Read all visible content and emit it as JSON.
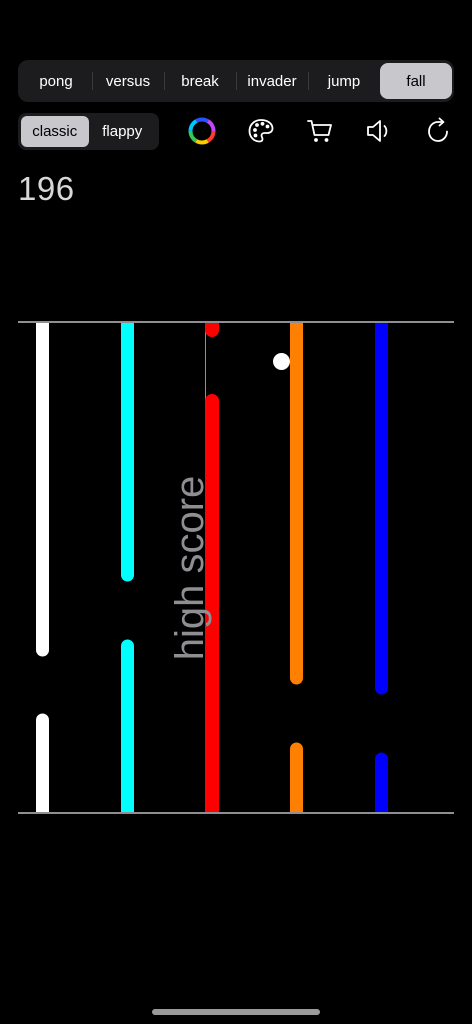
{
  "modes": {
    "tabs": [
      {
        "label": "pong",
        "selected": false
      },
      {
        "label": "versus",
        "selected": false
      },
      {
        "label": "break",
        "selected": false
      },
      {
        "label": "invader",
        "selected": false
      },
      {
        "label": "jump",
        "selected": false
      },
      {
        "label": "fall",
        "selected": true
      }
    ]
  },
  "variants": {
    "tabs": [
      {
        "label": "classic",
        "selected": true
      },
      {
        "label": "flappy",
        "selected": false
      }
    ]
  },
  "toolbar": {
    "icons": [
      "color-wheel-icon",
      "palette-icon",
      "cart-icon",
      "speaker-icon",
      "refresh-icon"
    ]
  },
  "game": {
    "score": "196",
    "high_score_label": "high score",
    "colors": {
      "background": "#000000",
      "boundary": "#8e8e93",
      "ball": "#ffffff",
      "bar_white": "#ffffff",
      "bar_cyan": "#00ffff",
      "bar_red": "#ff0000",
      "bar_orange": "#ff8000",
      "bar_blue": "#0000ff"
    }
  }
}
